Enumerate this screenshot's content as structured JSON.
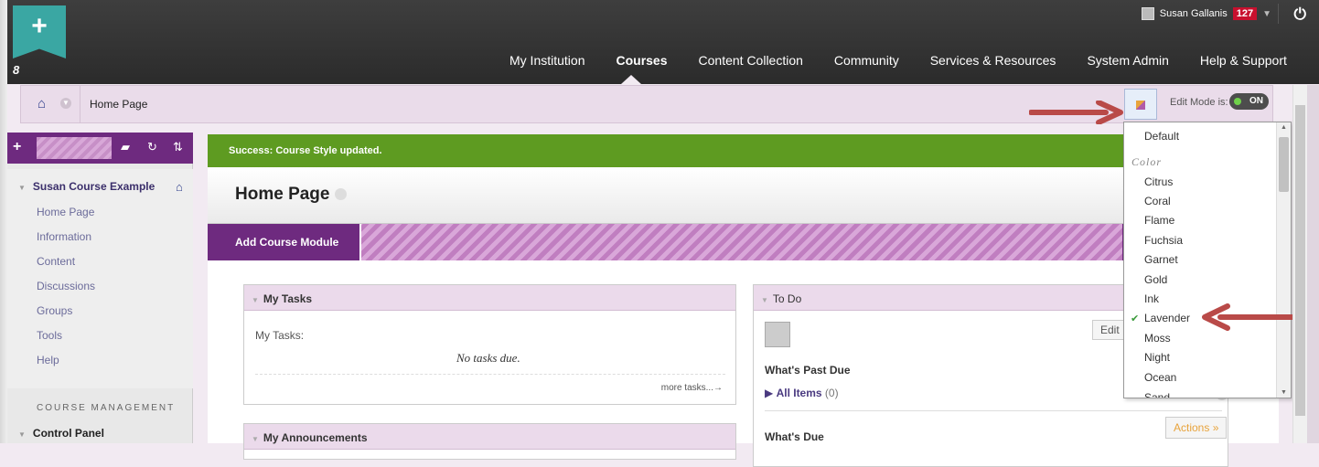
{
  "topbar": {
    "logo_symbol": "+",
    "logo_mark": "8",
    "user_name": "Susan Gallanis",
    "notification_count": "127",
    "power_icon": "⏻",
    "nav": [
      "My Institution",
      "Courses",
      "Content Collection",
      "Community",
      "Services & Resources",
      "System Admin",
      "Help & Support"
    ],
    "active_nav": "Courses"
  },
  "breadcrumb": {
    "title": "Home Page"
  },
  "edit_mode": {
    "label": "Edit Mode is:",
    "state": "ON"
  },
  "sidebar": {
    "course_name": "Susan Course Example",
    "items": [
      "Home Page",
      "Information",
      "Content",
      "Discussions",
      "Groups",
      "Tools",
      "Help"
    ],
    "section_label": "COURSE MANAGEMENT",
    "control_panel": "Control Panel"
  },
  "main": {
    "success_message": "Success: Course Style updated.",
    "page_title": "Home Page",
    "add_module": "Add Course Module",
    "my_tasks": {
      "title": "My Tasks",
      "label": "My Tasks:",
      "empty": "No tasks due.",
      "more": "more tasks...→"
    },
    "my_announcements": {
      "title": "My Announcements"
    },
    "todo": {
      "title": "To Do",
      "edit": "Edit",
      "past_due": "What's Past Due",
      "all_items": "All Items",
      "all_items_count": "(0)",
      "due": "What's Due",
      "actions": "Actions"
    }
  },
  "style_dropdown": {
    "default": "Default",
    "group_label": "Color",
    "options": [
      "Citrus",
      "Coral",
      "Flame",
      "Fuchsia",
      "Garnet",
      "Gold",
      "Ink",
      "Lavender",
      "Moss",
      "Night",
      "Ocean",
      "Sand"
    ],
    "selected": "Lavender"
  },
  "colors": {
    "theme": "#6e2a7f",
    "success": "#5e9b21",
    "accent_arrow": "#b94a48"
  }
}
